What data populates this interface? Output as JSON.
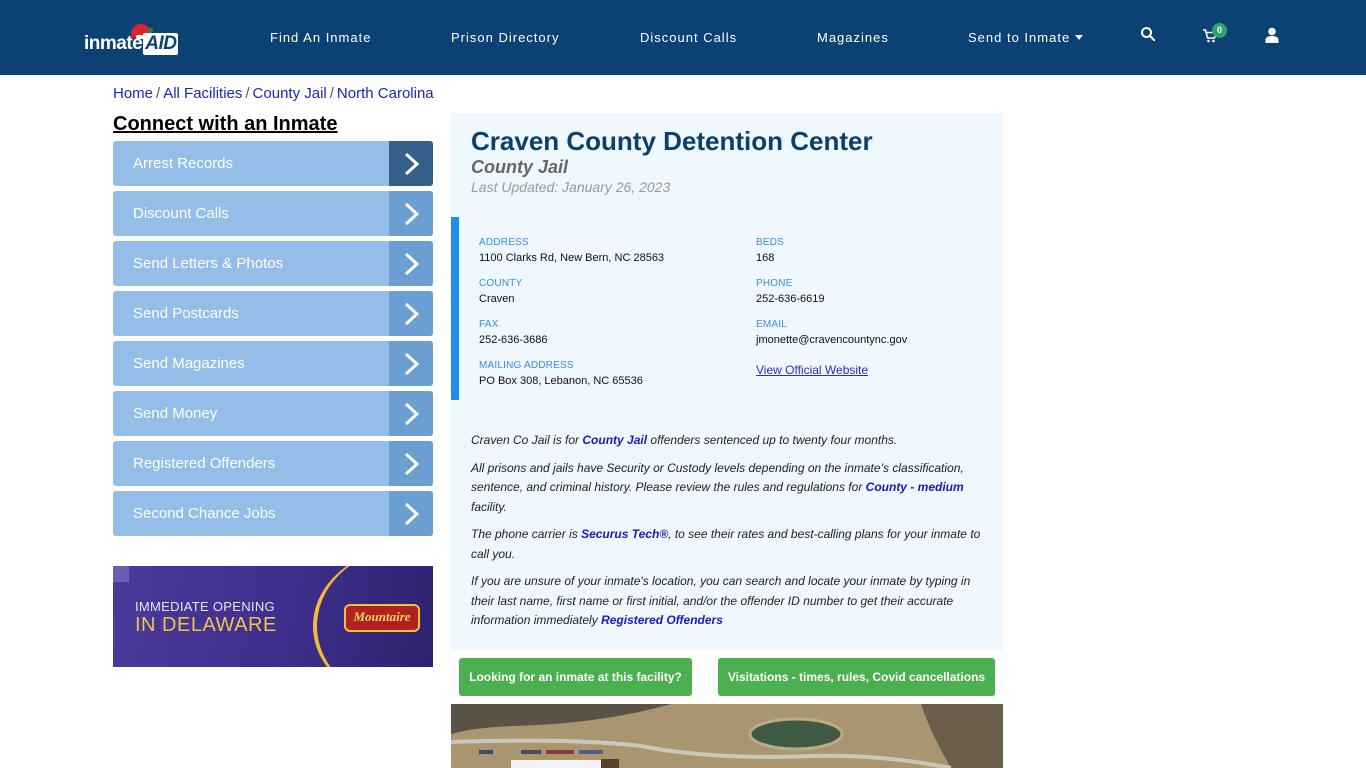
{
  "header": {
    "logo_text": "inmate",
    "logo_accent": "AID",
    "nav": [
      {
        "label": "Find An Inmate"
      },
      {
        "label": "Prison Directory"
      },
      {
        "label": "Discount Calls"
      },
      {
        "label": "Magazines"
      },
      {
        "label": "Send to Inmate",
        "has_dropdown": true
      }
    ],
    "icons": [
      "search-icon",
      "cart-icon",
      "user-icon"
    ],
    "cart_count": "0",
    "colors": {
      "bar": "#0b4273",
      "cart_badge": "#2ea36b"
    }
  },
  "breadcrumb": [
    {
      "label": "Home"
    },
    {
      "label": "All Facilities"
    },
    {
      "label": "County Jail"
    },
    {
      "label": "North Carolina"
    }
  ],
  "sidebar": {
    "title": "Connect with an Inmate",
    "items": [
      {
        "label": "Arrest Records"
      },
      {
        "label": "Discount Calls"
      },
      {
        "label": "Send Letters & Photos"
      },
      {
        "label": "Send Postcards"
      },
      {
        "label": "Send Magazines"
      },
      {
        "label": "Send Money"
      },
      {
        "label": "Registered Offenders"
      },
      {
        "label": "Second Chance Jobs"
      }
    ],
    "ad": {
      "line1": "IMMEDIATE OPENING",
      "line2": "IN DELAWARE",
      "brand": "Mountaire"
    }
  },
  "facility": {
    "name": "Craven County Detention Center",
    "type": "County Jail",
    "last_updated": "Last Updated: January 26, 2023",
    "fields": {
      "address": {
        "label": "ADDRESS",
        "value": "1100 Clarks Rd, New Bern, NC 28563"
      },
      "county": {
        "label": "COUNTY",
        "value": "Craven"
      },
      "fax": {
        "label": "FAX",
        "value": "252-636-3686"
      },
      "mailing": {
        "label": "MAILING ADDRESS",
        "value": "PO Box 308, Lebanon, NC 65536"
      },
      "beds": {
        "label": "BEDS",
        "value": "168"
      },
      "phone": {
        "label": "PHONE",
        "value": "252-636-6619"
      },
      "email": {
        "label": "EMAIL",
        "value": "jmonette@cravencountync.gov"
      }
    },
    "website_link": "View Official Website",
    "description": {
      "p1_a": "Craven Co Jail is for ",
      "p1_link": "County Jail",
      "p1_b": " offenders sentenced up to twenty four months.",
      "p2_a": "All prisons and jails have Security or Custody levels depending on the inmate’s classification, sentence, and criminal history. Please review the rules and regulations for ",
      "p2_link": "County - medium",
      "p2_b": " facility.",
      "p3_a": "The phone carrier is ",
      "p3_link": "Securus Tech®",
      "p3_b": ", to see their rates and best-calling plans for your inmate to call you.",
      "p4_a": "If you are unsure of your inmate's location, you can search and locate your inmate by typing in their last name, first name or first initial, and/or the offender ID number to get their accurate information immediately ",
      "p4_link": "Registered Offenders"
    }
  },
  "buttons": {
    "find_inmate": "Looking for an inmate at this facility?",
    "visitations": "Visitations - times, rules, Covid cancellations"
  },
  "colors": {
    "accent_blue": "#1b8ef0",
    "panel_bg": "#eef8fe",
    "title_blue": "#0b3f6e",
    "button_green": "#4caf50",
    "sidebar_item": "#94bde7"
  }
}
